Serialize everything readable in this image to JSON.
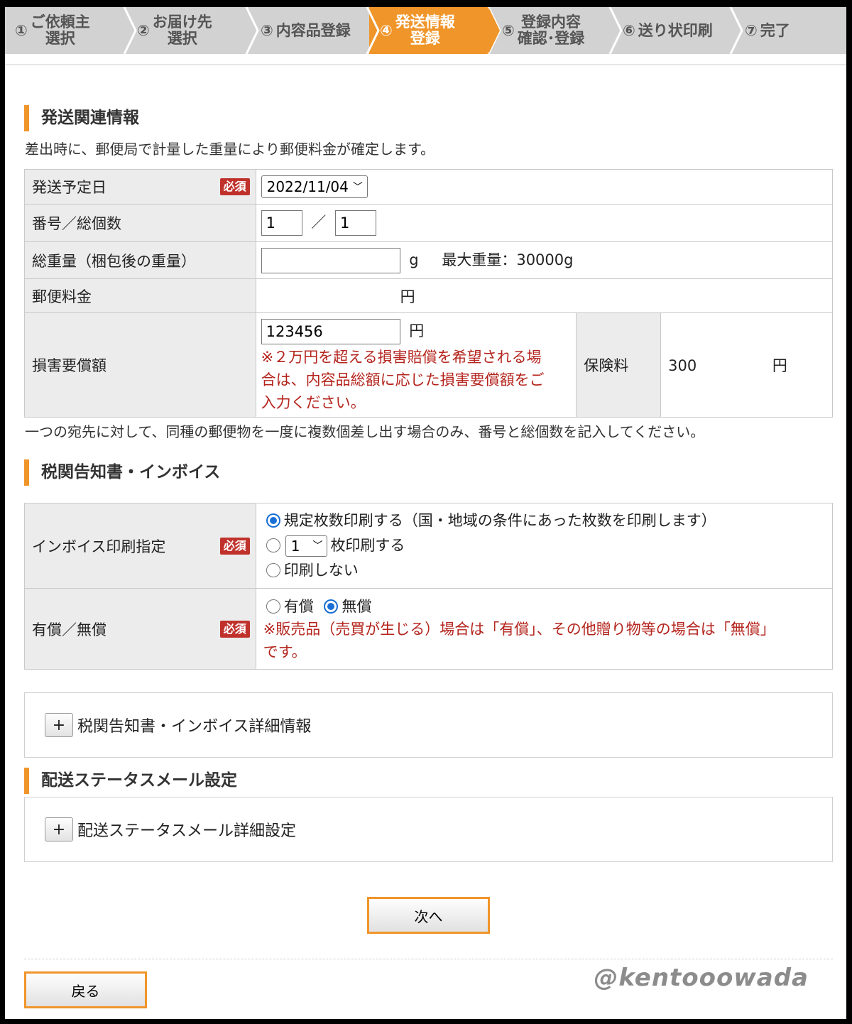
{
  "steps": [
    {
      "num": "①",
      "line1": "ご依頼主",
      "line2": "選択"
    },
    {
      "num": "②",
      "line1": "お届け先",
      "line2": "選択"
    },
    {
      "num": "③",
      "line1": "内容品登録",
      "line2": ""
    },
    {
      "num": "④",
      "line1": "発送情報",
      "line2": "登録"
    },
    {
      "num": "⑤",
      "line1": "登録内容",
      "line2": "確認･登録"
    },
    {
      "num": "⑥",
      "line1": "送り状印刷",
      "line2": ""
    },
    {
      "num": "⑦",
      "line1": "完了",
      "line2": ""
    }
  ],
  "colors": {
    "accent": "#f0952a",
    "required": "#c0312b",
    "warning_text": "#b4241d"
  },
  "shipping": {
    "heading": "発送関連情報",
    "note": "差出時に、郵便局で計量した重量により郵便料金が確定します。",
    "required_badge": "必須",
    "ship_date_label": "発送予定日",
    "ship_date_value": "2022/11/04",
    "count_label": "番号／総個数",
    "count_number": "1",
    "count_separator": "／",
    "count_total": "1",
    "weight_label": "総重量（梱包後の重量）",
    "weight_value": "",
    "weight_unit": "g",
    "weight_max": "最大重量：30000g",
    "postage_label": "郵便料金",
    "postage_unit": "円",
    "damage_label": "損害要償額",
    "damage_value": "123456",
    "damage_unit": "円",
    "damage_warning_1": "※２万円を超える損害賠償を希望される場",
    "damage_warning_2": "合は、内容品総額に応じた損害要償額をご",
    "damage_warning_3": "入力ください。",
    "insurance_label": "保険料",
    "insurance_value": "300",
    "insurance_unit": "円",
    "footnote": "一つの宛先に対して、同種の郵便物を一度に複数個差し出す場合のみ、番号と総個数を記入してください。"
  },
  "invoice": {
    "heading": "税関告知書・インボイス",
    "print_label": "インボイス印刷指定",
    "option_default": "規定枚数印刷する（国・地域の条件にあった枚数を印刷します）",
    "option_count_value": "1",
    "option_count_suffix": "枚印刷する",
    "option_none": "印刷しない",
    "paid_label": "有償／無償",
    "paid_option": "有償",
    "free_option": "無償",
    "paid_warning_1": "※販売品（売買が生じる）場合は「有償」、その他贈り物等の場合は「無償」",
    "paid_warning_2": "です。",
    "detail_toggle": "+",
    "detail_label": "税関告知書・インボイス詳細情報"
  },
  "mail": {
    "heading": "配送ステータスメール設定",
    "detail_toggle": "+",
    "detail_label": "配送ステータスメール詳細設定"
  },
  "buttons": {
    "next": "次へ",
    "back": "戻る"
  },
  "watermark": "@kentooowada"
}
